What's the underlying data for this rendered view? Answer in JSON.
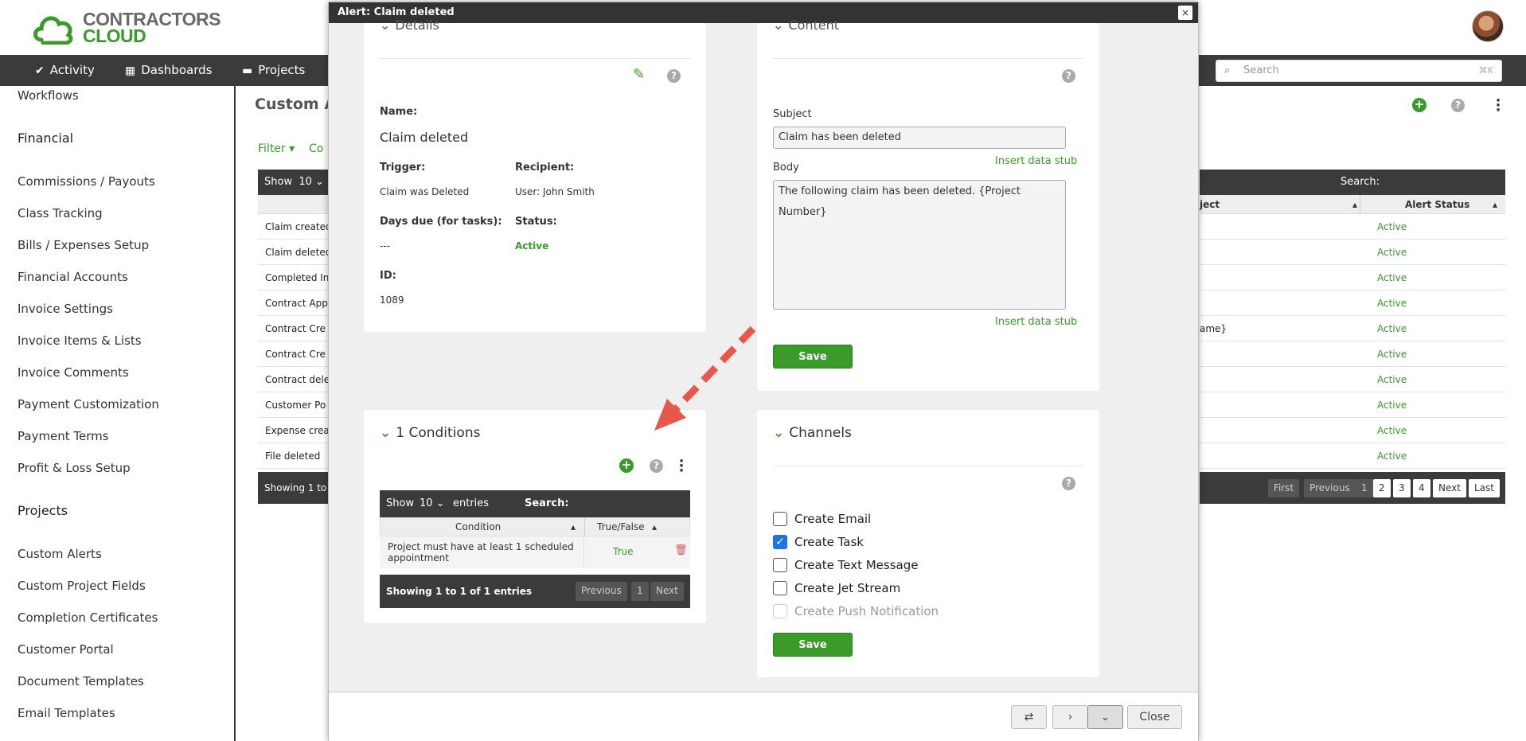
{
  "app": {
    "logo_line1": "CONTRACTORS",
    "logo_line2": "CLOUD"
  },
  "topnav": {
    "items": [
      {
        "label": "Activity",
        "icon": "check-circle-icon"
      },
      {
        "label": "Dashboards",
        "icon": "dashboard-grid-icon"
      },
      {
        "label": "Projects",
        "icon": "folder-icon"
      }
    ],
    "search_placeholder": "Search",
    "search_shortcut": "⌘K"
  },
  "sidebar": {
    "items": [
      {
        "label": "Workflows",
        "header": false
      },
      {
        "label": "Financial",
        "header": true
      },
      {
        "label": "Commissions / Payouts",
        "header": false
      },
      {
        "label": "Class Tracking",
        "header": false
      },
      {
        "label": "Bills / Expenses Setup",
        "header": false
      },
      {
        "label": "Financial Accounts",
        "header": false
      },
      {
        "label": "Invoice Settings",
        "header": false
      },
      {
        "label": "Invoice Items & Lists",
        "header": false
      },
      {
        "label": "Invoice Comments",
        "header": false
      },
      {
        "label": "Payment Customization",
        "header": false
      },
      {
        "label": "Payment Terms",
        "header": false
      },
      {
        "label": "Profit & Loss Setup",
        "header": false
      },
      {
        "label": "Projects",
        "header": true
      },
      {
        "label": "Custom Alerts",
        "header": false
      },
      {
        "label": "Custom Project Fields",
        "header": false
      },
      {
        "label": "Completion Certificates",
        "header": false
      },
      {
        "label": "Customer Portal",
        "header": false
      },
      {
        "label": "Document Templates",
        "header": false
      },
      {
        "label": "Email Templates",
        "header": false
      }
    ]
  },
  "background": {
    "title": "Custom A",
    "filter_label": "Filter",
    "filter_extra": "Co",
    "show_label": "Show",
    "show_value": "10",
    "rows": [
      "Claim created",
      "Claim deleted",
      "Completed In",
      "Contract App",
      "Contract Cre",
      "Contract Cre",
      "Contract dele",
      "Customer Po",
      "Expense crea",
      "File deleted"
    ],
    "right_rows": [
      "",
      "",
      "",
      "",
      "ame}",
      "",
      "",
      "",
      "",
      ""
    ],
    "status_values": [
      "Active",
      "Active",
      "Active",
      "Active",
      "Active",
      "Active",
      "Active",
      "Active",
      "Active",
      "Active"
    ],
    "footer_text": "Showing 1 to",
    "search_label": "Search:",
    "col_project": "ject",
    "col_status": "Alert Status",
    "pagination": [
      "First",
      "Previous",
      "1",
      "2",
      "3",
      "4",
      "Next",
      "Last"
    ]
  },
  "modal": {
    "title": "Alert: Claim deleted",
    "close_x": "×",
    "details": {
      "title": "Details",
      "name_label": "Name:",
      "name_value": "Claim deleted",
      "trigger_label": "Trigger:",
      "trigger_value": "Claim was Deleted",
      "recipient_label": "Recipient:",
      "recipient_value": "User: John Smith",
      "days_label": "Days due (for tasks):",
      "days_value": "---",
      "status_label": "Status:",
      "status_value": "Active",
      "id_label": "ID:",
      "id_value": "1089"
    },
    "content": {
      "title": "Content",
      "subject_label": "Subject",
      "subject_value": "Claim has been deleted",
      "insert_stub": "Insert data stub",
      "body_label": "Body",
      "body_value": "The following claim has been deleted. {Project Number}",
      "save_label": "Save"
    },
    "conditions": {
      "title": "1 Conditions",
      "show_label": "Show",
      "show_value": "10",
      "entries_label": "entries",
      "search_label": "Search:",
      "col_condition": "Condition",
      "col_truefalse": "True/False",
      "rows": [
        {
          "condition": "Project must have at least 1 scheduled appointment",
          "value": "True"
        }
      ],
      "footer_text": "Showing 1 to 1 of 1 entries",
      "pagination": [
        "Previous",
        "1",
        "Next"
      ]
    },
    "channels": {
      "title": "Channels",
      "options": [
        {
          "label": "Create Email",
          "checked": false,
          "disabled": false
        },
        {
          "label": "Create Task",
          "checked": true,
          "disabled": false
        },
        {
          "label": "Create Text Message",
          "checked": false,
          "disabled": false
        },
        {
          "label": "Create Jet Stream",
          "checked": false,
          "disabled": false
        },
        {
          "label": "Create Push Notification",
          "checked": false,
          "disabled": true
        }
      ],
      "save_label": "Save"
    },
    "footer": {
      "close_label": "Close"
    }
  },
  "colors": {
    "accent": "#3a9b2a",
    "dark": "#3b3b3b",
    "annotation_arrow": "#e8574a"
  }
}
